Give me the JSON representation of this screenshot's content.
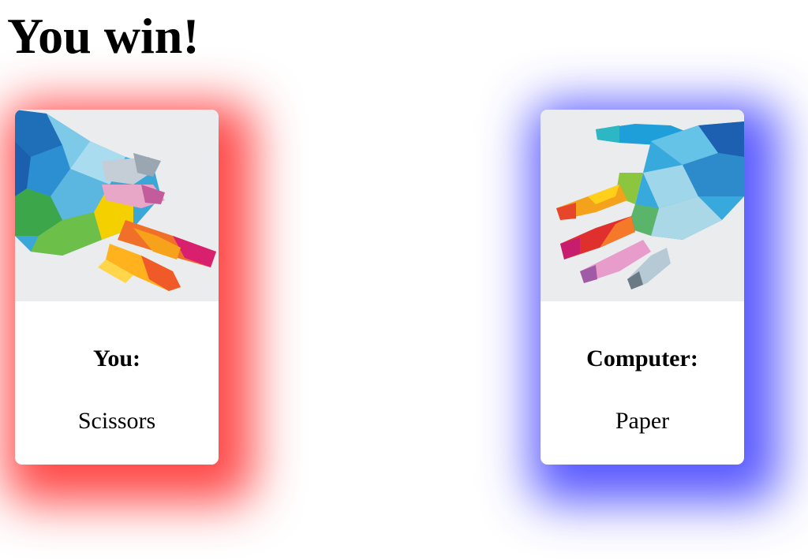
{
  "result": {
    "title": "You win!"
  },
  "player": {
    "label": "You:",
    "choice": "Scissors",
    "image_icon": "scissors-hand-icon",
    "glow_color": "#ff2828"
  },
  "computer": {
    "label": "Computer:",
    "choice": "Paper",
    "image_icon": "paper-hand-icon",
    "glow_color": "#3c3cff"
  }
}
